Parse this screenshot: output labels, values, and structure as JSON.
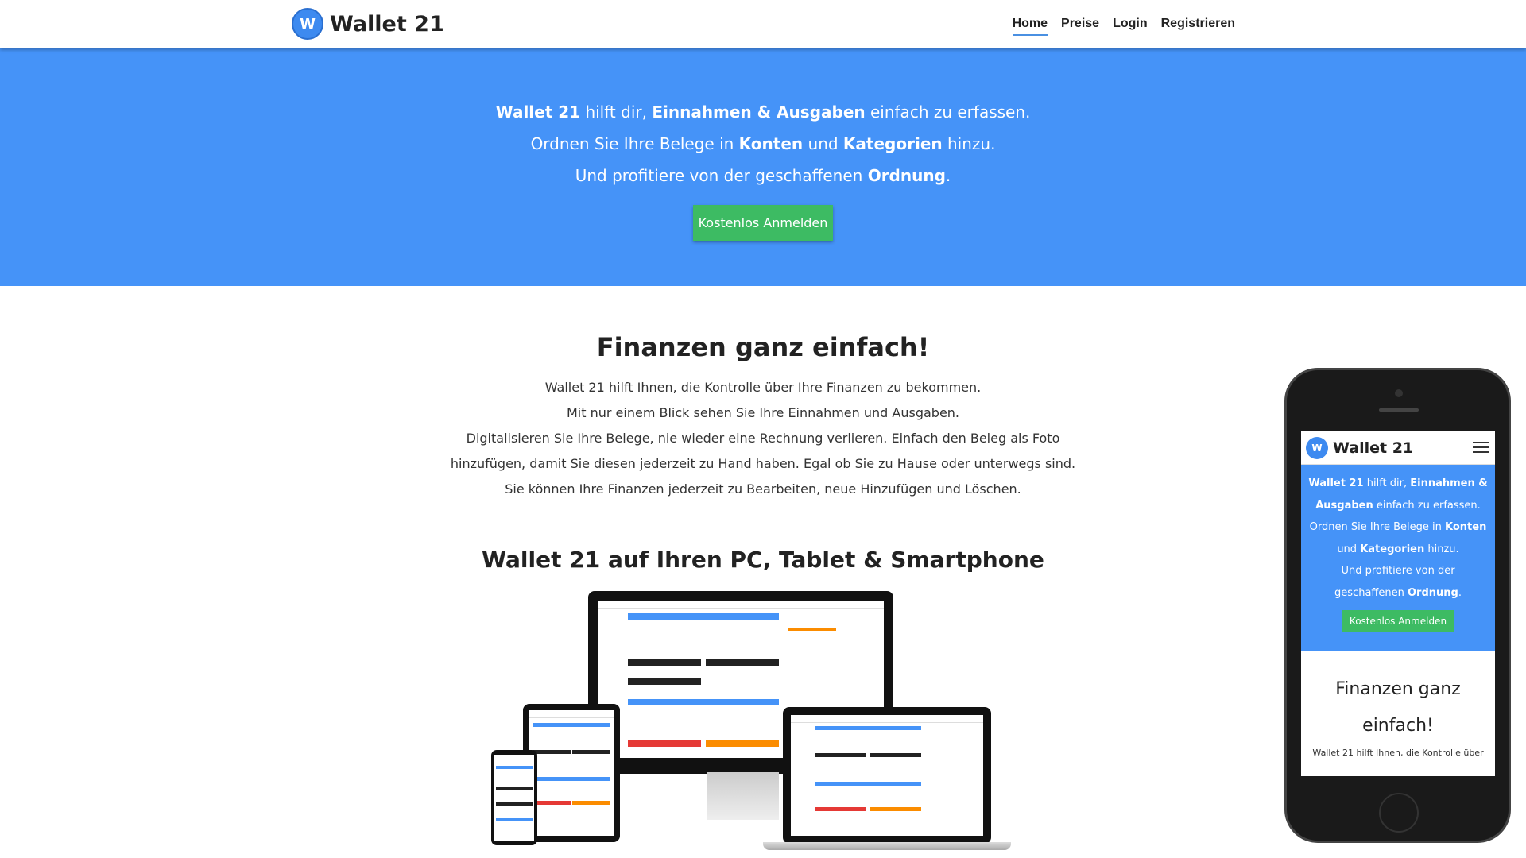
{
  "brand": {
    "logo_text": "W",
    "name": "Wallet 21"
  },
  "nav": {
    "items": [
      {
        "label": "Home"
      },
      {
        "label": "Preise"
      },
      {
        "label": "Login"
      },
      {
        "label": "Registrieren"
      }
    ]
  },
  "hero": {
    "line1": {
      "b1": "Wallet 21",
      "t1": " hilft dir, ",
      "b2": "Einnahmen & Ausgaben",
      "t2": " einfach zu erfassen."
    },
    "line2": {
      "t1": "Ordnen Sie Ihre Belege in ",
      "b1": "Konten",
      "t2": " und ",
      "b2": "Kategorien",
      "t3": " hinzu."
    },
    "line3": {
      "t1": "Und profitiere von der geschaffenen ",
      "b1": "Ordnung",
      "t2": "."
    },
    "cta_label": "Kostenlos Anmelden"
  },
  "main": {
    "title": "Finanzen ganz einfach!",
    "paragraph": [
      "Wallet 21 hilft Ihnen, die Kontrolle über Ihre Finanzen zu bekommen.",
      "Mit nur einem Blick sehen Sie Ihre Einnahmen und Ausgaben.",
      "Digitalisieren Sie Ihre Belege, nie wieder eine Rechnung verlieren. Einfach den Beleg als Foto hinzufügen, damit Sie diesen jederzeit zu Hand haben. Egal ob Sie zu Hause oder unterwegs sind. Sie können Ihre Finanzen jederzeit zu Bearbeiten, neue Hinzufügen und Löschen."
    ],
    "devices_title": "Wallet 21 auf Ihren PC, Tablet & Smartphone"
  },
  "mobile": {
    "brand": "Wallet 21",
    "hero": {
      "b1": "Wallet 21",
      "t1": " hilft dir, ",
      "b2": "Einnahmen & Ausgaben",
      "t2": " einfach zu erfassen.",
      "t3": "Ordnen Sie Ihre Belege in ",
      "b3": "Konten",
      "t4": " und ",
      "b4": "Kategorien",
      "t5": " hinzu.",
      "t6": "Und profitiere von der geschaffenen ",
      "b5": "Ordnung",
      "t7": ".",
      "cta_label": "Kostenlos Anmelden"
    },
    "title": "Finanzen ganz einfach!",
    "text": "Wallet 21 hilft Ihnen, die Kontrolle über"
  },
  "colors": {
    "hero_bg": "#4593f8",
    "cta": "#3dbb63",
    "accent": "#4a90e2"
  }
}
